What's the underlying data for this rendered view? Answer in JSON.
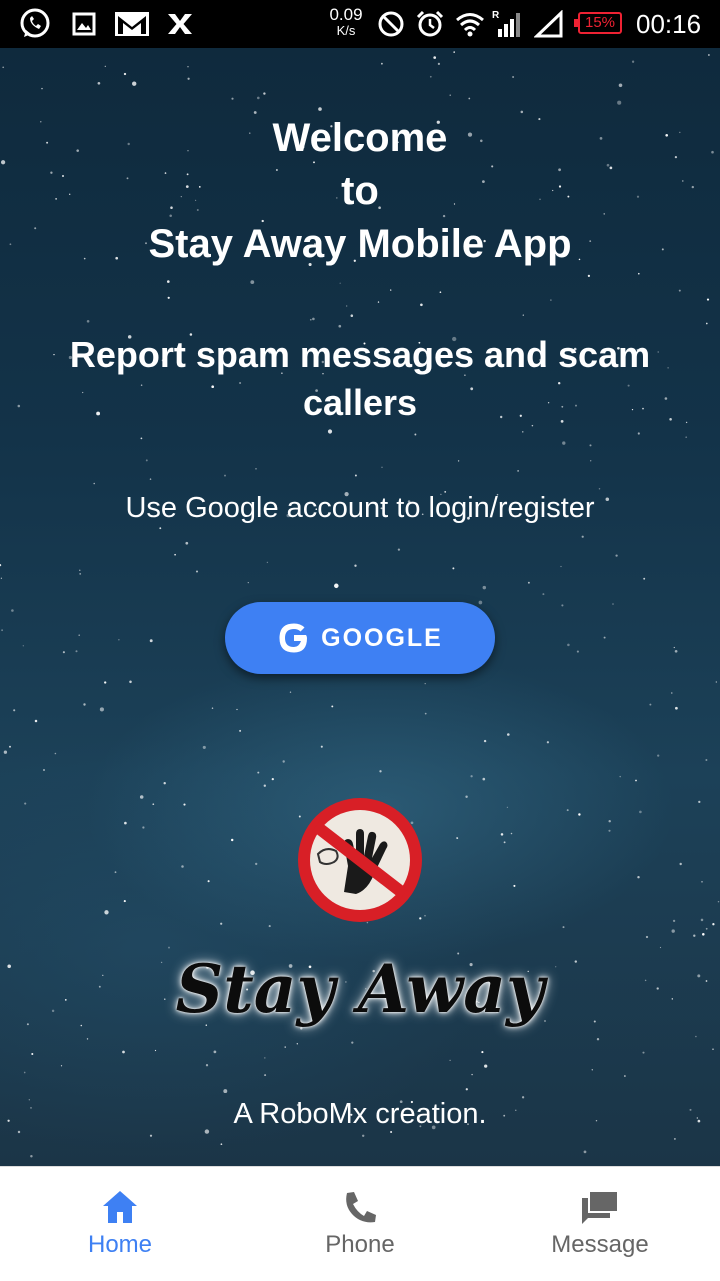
{
  "status_bar": {
    "speed_value": "0.09",
    "speed_unit": "K/s",
    "battery": "15%",
    "time": "00:16",
    "icons": [
      "whatsapp-icon",
      "gallery-icon",
      "gmail-icon",
      "x-app-icon",
      "do-not-disturb-icon",
      "alarm-icon",
      "wifi-icon",
      "signal-icon",
      "signal-empty-icon",
      "battery-icon"
    ]
  },
  "main": {
    "welcome_lines": [
      "Welcome",
      "to",
      "Stay Away Mobile App"
    ],
    "tagline": "Report spam messages and scam callers",
    "instruction": "Use Google account to login/register",
    "google_button_label": "GOOGLE",
    "logo_text": "Stay Away",
    "credit": "A RoboMx creation."
  },
  "nav": {
    "items": [
      {
        "label": "Home",
        "icon": "home-icon",
        "active": true
      },
      {
        "label": "Phone",
        "icon": "phone-icon",
        "active": false
      },
      {
        "label": "Message",
        "icon": "message-icon",
        "active": false
      }
    ]
  },
  "colors": {
    "accent": "#3e80f3",
    "battery_low": "#e23",
    "nav_inactive": "#666666"
  }
}
